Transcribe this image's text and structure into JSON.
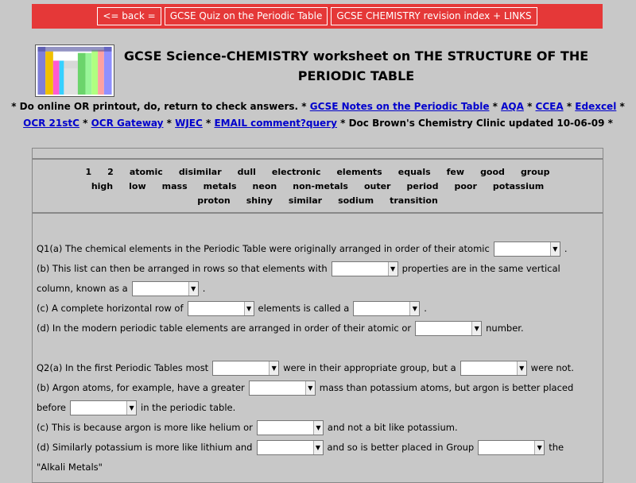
{
  "nav": {
    "back": "<= back =",
    "quiz": "GCSE Quiz on the Periodic Table",
    "index": "GCSE CHEMISTRY revision index + LINKS"
  },
  "header": {
    "title_line1": "GCSE Science-CHEMISTRY worksheet on THE STRUCTURE OF THE",
    "title_line2": "PERIODIC TABLE"
  },
  "info": {
    "pre": "* Do online OR printout, do, return to check answers. * ",
    "link_notes": "GCSE Notes on the Periodic Table",
    "star1": " * ",
    "link_aqa": "AQA",
    "star2": " * ",
    "link_ccea": "CCEA",
    "star3": " * ",
    "link_edexcel": "Edexcel",
    "star4": " *",
    "link_ocr21": "OCR 21stC",
    "star5": " * ",
    "link_ocrg": "OCR Gateway",
    "star6": " * ",
    "link_wjec": "WJEC",
    "star7": " * ",
    "link_email": "EMAIL comment?query",
    "post": " * Doc Brown's Chemistry Clinic updated 10-06-09 *"
  },
  "wordbank": {
    "row1": [
      "1",
      "2",
      "atomic",
      "disimilar",
      "dull",
      "electronic",
      "elements",
      "equals",
      "few",
      "good",
      "group"
    ],
    "row2": [
      "high",
      "low",
      "mass",
      "metals",
      "neon",
      "non-metals",
      "outer",
      "period",
      "poor",
      "potassium"
    ],
    "row3": [
      "proton",
      "shiny",
      "similar",
      "sodium",
      "transition"
    ]
  },
  "questions": {
    "q1a": "Q1(a) The chemical elements in the Periodic Table were originally arranged in order of their atomic",
    "q1a_end": ".",
    "q1b_1": "(b) This list can then be arranged in rows so that elements with",
    "q1b_2": "properties are in the same vertical",
    "q1b_3": "column, known as a",
    "q1b_end": ".",
    "q1c_1": "(c) A complete horizontal row of",
    "q1c_2": "elements is called a",
    "q1c_end": ".",
    "q1d_1": "(d) In the modern periodic table elements are arranged in order of their atomic or",
    "q1d_2": "number.",
    "q2a_1": "Q2(a) In the first Periodic Tables most",
    "q2a_2": "were in their appropriate group, but a",
    "q2a_3": "were not.",
    "q2b_1": "(b) Argon atoms, for example, have a greater",
    "q2b_2": "mass than potassium atoms, but argon is better placed",
    "q2b_3": "before",
    "q2b_4": "in the periodic table.",
    "q2c_1": "(c) This is because argon is more like helium or",
    "q2c_2": "and not a bit like potassium.",
    "q2d_1": "(d) Similarly potassium is more like lithium and",
    "q2d_2": "and so is better placed in Group",
    "q2d_3": "the",
    "q2d_4": "\"Alkali Metals\""
  }
}
